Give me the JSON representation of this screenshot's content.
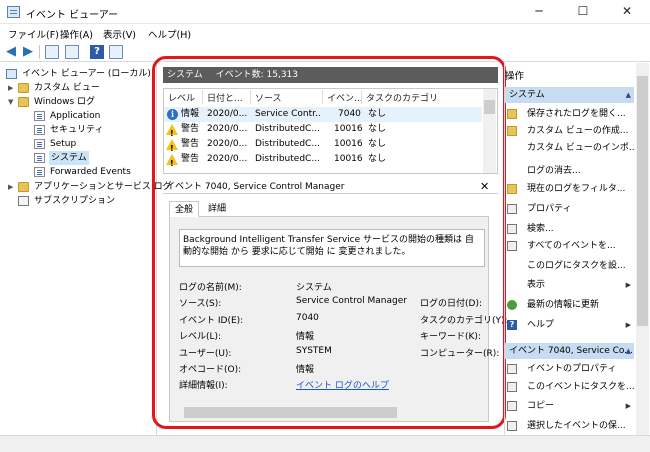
{
  "window": {
    "title": "イベント ビューアー",
    "minimize": "─",
    "maximize": "☐",
    "close": "✕"
  },
  "menu": [
    "ファイル(F)",
    "操作(A)",
    "表示(V)",
    "ヘルプ(H)"
  ],
  "tree": {
    "root": "イベント ビューアー (ローカル)",
    "custom_views": "カスタム ビュー",
    "windows_logs": "Windows ログ",
    "logs": [
      "Application",
      "セキュリティ",
      "Setup",
      "システム",
      "Forwarded Events"
    ],
    "app_service_logs": "アプリケーションとサービス ログ",
    "subscriptions": "サブスクリプション"
  },
  "center": {
    "header_title": "システム",
    "header_count": "イベント数: 15,313",
    "columns": [
      "レベル",
      "日付と...",
      "ソース",
      "イベン...",
      "タスクのカテゴリ"
    ],
    "rows": [
      {
        "level": "情報",
        "type": "info",
        "date": "2020/0...",
        "source": "Service Contr...",
        "id": "7040",
        "category": "なし"
      },
      {
        "level": "警告",
        "type": "warn",
        "date": "2020/0...",
        "source": "DistributedC...",
        "id": "10016",
        "category": "なし"
      },
      {
        "level": "警告",
        "type": "warn",
        "date": "2020/0...",
        "source": "DistributedC...",
        "id": "10016",
        "category": "なし"
      },
      {
        "level": "警告",
        "type": "warn",
        "date": "2020/0...",
        "source": "DistributedC...",
        "id": "10016",
        "category": "なし"
      }
    ],
    "detail_title": "イベント 7040, Service Control Manager",
    "close_label": "✕",
    "tabs": [
      "全般",
      "詳細"
    ],
    "description": "Background Intelligent Transfer Service サービスの開始の種類は 自動的な開始 から 要求に応じて開始 に 変更されました。",
    "properties": {
      "log_name_label": "ログの名前(M):",
      "log_name_value": "システム",
      "source_label": "ソース(S):",
      "source_value": "Service Control Manager",
      "logged_label": "ログの日付(D):",
      "event_id_label": "イベント ID(E):",
      "event_id_value": "7040",
      "task_cat_label": "タスクのカテゴリ(Y):",
      "level_label": "レベル(L):",
      "level_value": "情報",
      "keywords_label": "キーワード(K):",
      "user_label": "ユーザー(U):",
      "user_value": "SYSTEM",
      "computer_label": "コンピューター(R):",
      "opcode_label": "オペコード(O):",
      "opcode_value": "情報",
      "more_info_label": "詳細情報(I):",
      "more_info_link": "イベント ログのヘルプ"
    }
  },
  "actions": {
    "header": "操作",
    "section1": "システム",
    "items1": [
      {
        "label": "保存されたログを開く...",
        "icon": "folder-open-icon"
      },
      {
        "label": "カスタム ビューの作成...",
        "icon": "filter-icon"
      },
      {
        "label": "カスタム ビューのインポ...",
        "icon": "import-icon"
      },
      {
        "label": "ログの消去...",
        "icon": "none"
      },
      {
        "label": "現在のログをフィルタ...",
        "icon": "filter-icon"
      },
      {
        "label": "プロパティ",
        "icon": "properties-icon"
      },
      {
        "label": "検索...",
        "icon": "find-icon"
      },
      {
        "label": "すべてのイベントを...",
        "icon": "save-icon"
      },
      {
        "label": "このログにタスクを設...",
        "icon": "none"
      },
      {
        "label": "表示",
        "icon": "none",
        "submenu": true
      },
      {
        "label": "最新の情報に更新",
        "icon": "refresh-icon"
      },
      {
        "label": "ヘルプ",
        "icon": "help-icon",
        "submenu": true
      }
    ],
    "section2": "イベント 7040, Service Co...",
    "items2": [
      {
        "label": "イベントのプロパティ",
        "icon": "properties-icon"
      },
      {
        "label": "このイベントにタスクを...",
        "icon": "task-icon"
      },
      {
        "label": "コピー",
        "icon": "copy-icon",
        "submenu": true
      },
      {
        "label": "選択したイベントの保...",
        "icon": "save-icon"
      }
    ]
  },
  "colors": {
    "highlight": "#e2161c",
    "header_bar": "#5c5c5c",
    "section_bg": "#c6dcf2",
    "link": "#1a56c7"
  }
}
